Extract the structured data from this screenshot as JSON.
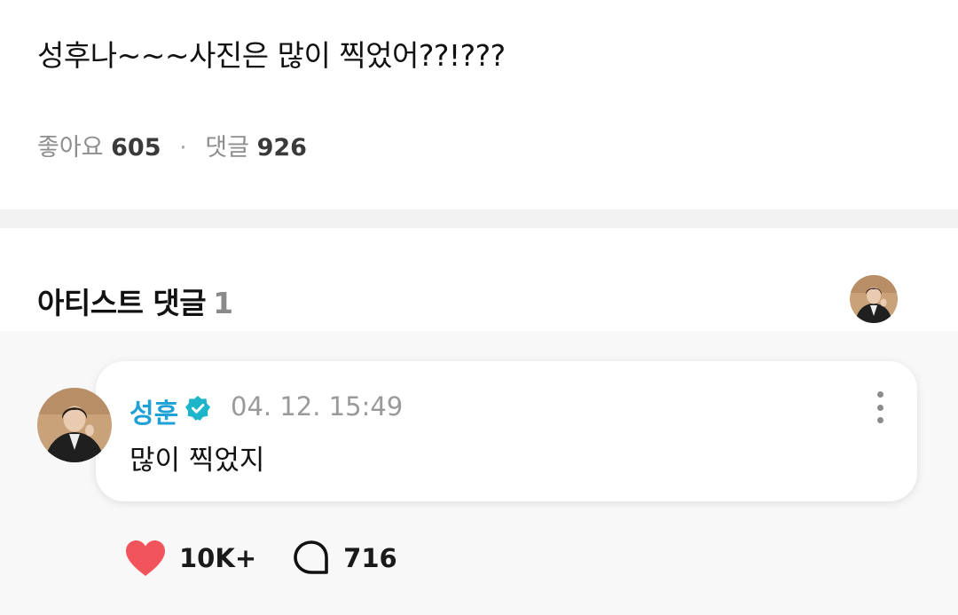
{
  "post": {
    "text": "성후나~~~사진은 많이 찍었어??!???",
    "likes_label": "좋아요",
    "likes_count": "605",
    "separator": "·",
    "comments_label": "댓글",
    "comments_count": "926"
  },
  "artist_section": {
    "title": "아티스트 댓글",
    "count": "1",
    "avatar_icon": "artist-avatar"
  },
  "comment": {
    "author": "성훈",
    "verified_icon": "verified-badge-icon",
    "timestamp": "04. 12. 15:49",
    "text": "많이 찍었지",
    "more_icon": "more-vertical-icon",
    "likes": "10K+",
    "replies": "716"
  },
  "colors": {
    "author": "#1da1d6",
    "verified": "#1db5c9",
    "heart": "#f2545b",
    "divider": "#f2f2f2",
    "comment_bg": "#f8f8f8"
  }
}
